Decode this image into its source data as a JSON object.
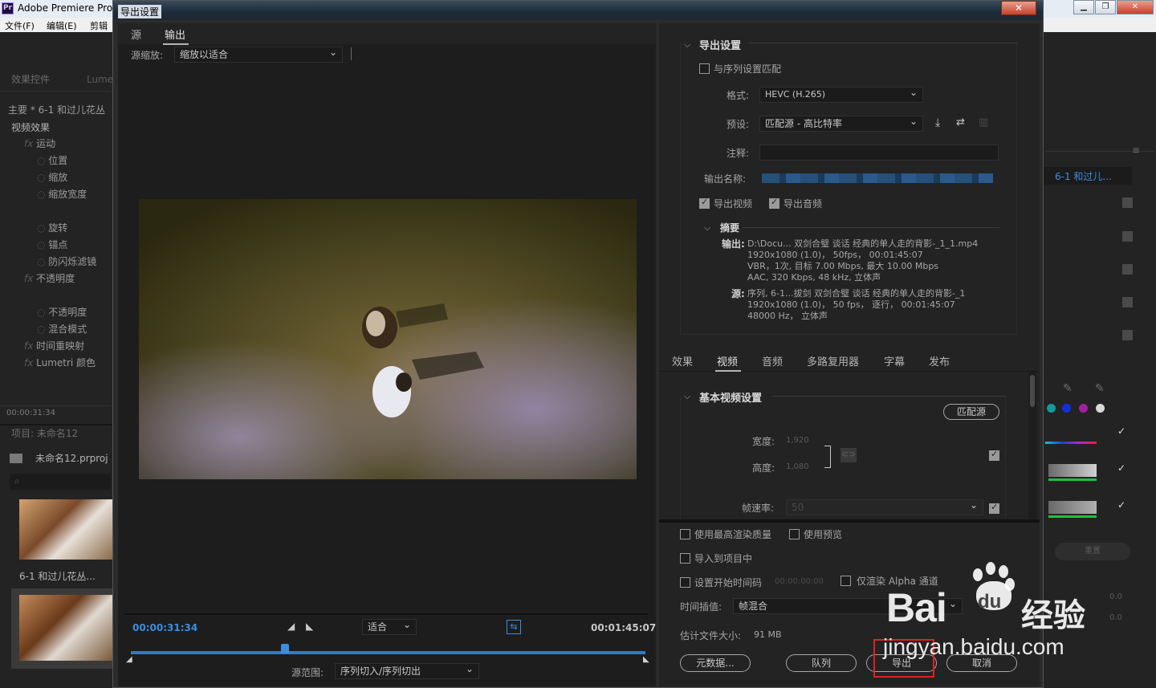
{
  "app": {
    "title": "Adobe Premiere Pro",
    "menu": [
      "文件(F)",
      "编辑(E)",
      "剪辑"
    ]
  },
  "left_panel": {
    "tabs": [
      "效果控件",
      "Lume"
    ],
    "clip": "主要 * 6-1  和过儿花丛",
    "section": "视频效果",
    "effects": [
      {
        "label": "运动",
        "fx": true
      },
      {
        "label": "位置",
        "fx": false
      },
      {
        "label": "缩放",
        "fx": false
      },
      {
        "label": "缩放宽度",
        "fx": false
      },
      {
        "label": "",
        "fx": false
      },
      {
        "label": "旋转",
        "fx": false
      },
      {
        "label": "锚点",
        "fx": false
      },
      {
        "label": "防闪烁滤镜",
        "fx": false
      },
      {
        "label": "不透明度",
        "fx": true
      },
      {
        "label": "",
        "fx": false
      },
      {
        "label": "不透明度",
        "fx": false
      },
      {
        "label": "混合模式",
        "fx": false
      },
      {
        "label": "时间重映射",
        "fx": true
      },
      {
        "label": "Lumetri 颜色",
        "fx": true
      }
    ],
    "timecode": "00:00:31:34",
    "project_tab": "项目: 未命名12",
    "project_file": "未命名12.prproj",
    "thumb1_label": "6-1  和过儿花丛..."
  },
  "right_panel": {
    "clip_label": "6-1  和过儿...",
    "reset_label": "重置",
    "val1": "0.0",
    "val2": "0.0"
  },
  "dialog": {
    "title": "导出设置",
    "close": "✕",
    "tabs": {
      "source": "源",
      "output": "输出"
    },
    "source_scale_label": "源缩放:",
    "source_scale_value": "缩放以适合",
    "timeline": {
      "current": "00:00:31:34",
      "duration": "00:01:45:07",
      "fit": "适合",
      "source_range_label": "源范围:",
      "source_range_value": "序列切入/序列切出",
      "playhead": 0.3
    },
    "export_settings": {
      "title": "导出设置",
      "match_sequence": "与序列设置匹配",
      "format_label": "格式:",
      "format_value": "HEVC (H.265)",
      "preset_label": "预设:",
      "preset_value": "匹配源 - 高比特率",
      "comment_label": "注释:",
      "output_name_label": "输出名称:",
      "export_video": "导出视频",
      "export_audio": "导出音频"
    },
    "summary": {
      "title": "摘要",
      "output_label": "输出:",
      "output_lines": [
        "D:\\Docu... 双剑合璧  谈话 经典的单人走的背影-_1_1.mp4",
        "1920x1080 (1.0)， 50fps， 00:01:45:07",
        "VBR，1次, 目标 7.00 Mbps, 最大 10.00 Mbps",
        "AAC, 320 Kbps, 48  kHz, 立体声"
      ],
      "source_label": "源:",
      "source_lines": [
        "序列, 6-1...拔剑 双剑合璧  谈话 经典的单人走的背影-_1",
        "1920x1080 (1.0)， 50 fps， 逐行， 00:01:45:07",
        "48000 Hz， 立体声"
      ]
    },
    "panel_tabs": [
      "效果",
      "视频",
      "音频",
      "多路复用器",
      "字幕",
      "发布"
    ],
    "video": {
      "title": "基本视频设置",
      "match_source": "匹配源",
      "width_label": "宽度:",
      "width_value": "1,920",
      "height_label": "高度:",
      "height_value": "1,080",
      "fps_label": "帧速率:",
      "fps_value": "50"
    },
    "options": {
      "max_render": "使用最高渲染质量",
      "use_preview": "使用预览",
      "import_project": "导入到项目中",
      "set_start_tc": "设置开始时间码",
      "start_tc_value": "00:00:00:00",
      "render_alpha": "仅渲染 Alpha 通道",
      "interp_label": "时间插值:",
      "interp_value": "帧混合",
      "filesize_label": "估计文件大小:",
      "filesize_value": "91 MB"
    },
    "buttons": {
      "metadata": "元数据...",
      "queue": "队列",
      "export": "导出",
      "cancel": "取消"
    }
  },
  "watermark": {
    "brand": "Bai",
    "brand2": "du",
    "jingyan": "经验",
    "url": "jingyan.baidu.com"
  },
  "colors": {
    "accent": "#3a8ee0",
    "highlight_box": "#e02020"
  }
}
